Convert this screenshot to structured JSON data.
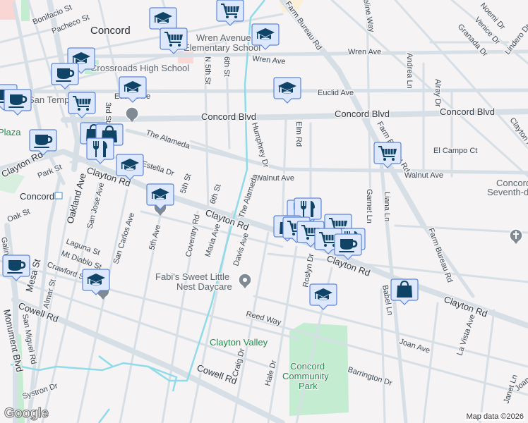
{
  "map": {
    "city_label": "Concord",
    "station_label": "Concord",
    "streets": {
      "bonifacio": "Bonifacio St",
      "pacheco": "Pacheco St",
      "third": "3rd St",
      "n5th": "N 5th St",
      "sixth_n": "6th St",
      "euclid_w": "Euclid Ave",
      "euclid_e": "Euclid Ave",
      "wren_w": "Wren Ave",
      "wren_e": "Wren Ave",
      "concord_blvd_1": "Concord Blvd",
      "concord_blvd_2": "Concord Blvd",
      "concord_blvd_3": "Concord Blvd",
      "alameda": "The Alameda",
      "alameda_v": "The Alameda",
      "humphrey": "Humphrey Dr",
      "elm": "Elm Rd",
      "farm_bureau_1": "Farm Bureau Rd",
      "farm_bureau_2": "Farm Bureau Rd",
      "farm_bureau_3": "Farm Bureau Rd",
      "walnut_w": "Walnut Ave",
      "walnut_e": "Walnut Ave",
      "el_campo": "El Campo Ct",
      "andrea": "Andrea Ln",
      "alray": "Alray Dr",
      "noemi": "Noemi Dr",
      "venice": "Venice Dr",
      "granada": "Granada Dr",
      "lindero": "Lindero Dr",
      "jacqueline": "Jacqueline Way",
      "clayton_ne": "Clayton Rd",
      "clayton_w": "Clayton Rd",
      "clayton_1": "Clayton Rd",
      "clayton_2": "Clayton Rd",
      "clayton_3": "Clayton Rd",
      "clayton_4": "Clayton Rd",
      "estella": "Estella Dr",
      "fifth_st": "5th St",
      "sixth_st": "6th St",
      "park": "Park St",
      "oak": "Oak St",
      "oakland": "Oakland Ave",
      "san_jose": "San Jose Ave",
      "san_carlos": "San Carlos Ave",
      "fifth_ave": "5th Ave",
      "coventry": "Coventry Rd",
      "maria": "Maria Ave",
      "davis": "Davis Ave",
      "laguna": "Laguna St",
      "mt_diablo": "Mt Diablo St",
      "crawford": "Crawford St",
      "mesa": "Mesa St",
      "almar": "Almar St",
      "galindo": "Galindo St",
      "monument": "Monument Blvd",
      "cowell_1": "Cowell Rd",
      "cowell_2": "Cowell Rd",
      "san_miguel": "San Miguel Rd",
      "systron": "Systron Dr",
      "reed": "Reed Way",
      "craig": "Craig Dr",
      "hale": "Hale Dr",
      "roslyn": "Roslyn Dr",
      "babel": "Babel Ln",
      "garnet": "Garnet Ln",
      "liana": "Liana Ln",
      "joan": "Joan Ave",
      "joan_e": "Joan Ave",
      "barrington": "Barrington Dr",
      "la_vista": "La Vista Ave",
      "janet": "Janet Ln"
    },
    "places": {
      "wren_school_1": "Wren Avenue",
      "wren_school_2": "Elementary School",
      "crossroads": "Crossroads High School",
      "san_temp": "San Temp",
      "plaza": "Plaza",
      "daycare_1": "Fabi's Sweet Little",
      "daycare_2": "Nest Daycare",
      "clayton_valley": "Clayton Valley",
      "park_1": "Concord",
      "park_2": "Community",
      "park_3": "Park",
      "church_1": "Concord",
      "church_2": "Seventh-d"
    },
    "marker_types": [
      "school",
      "grocery",
      "cafe",
      "shopping",
      "restaurant"
    ],
    "colors": {
      "marker_fill": "#dde8fc",
      "marker_border": "#5d86d8",
      "icon": "#0f4466",
      "road": "#d6dee6",
      "creek": "#90dbe9",
      "park": "#c3ecd0"
    }
  },
  "footer": {
    "logo": "Google",
    "attribution": "Map data ©2026"
  }
}
